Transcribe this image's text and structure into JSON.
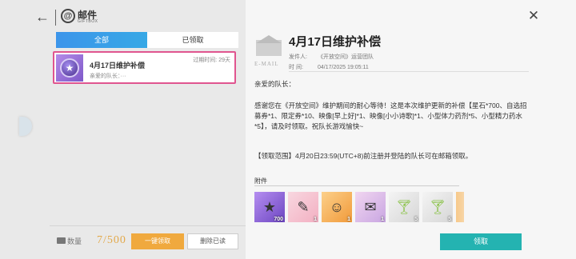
{
  "header": {
    "title": "邮件",
    "subtitle": "GIFTBOX"
  },
  "tabs": [
    {
      "label": "全部",
      "active": true
    },
    {
      "label": "已领取",
      "active": false
    }
  ],
  "mail_list": [
    {
      "title": "4月17日维护补偿",
      "expire": "过期时间: 29天",
      "preview": "亲爱的队长：···",
      "selected": true
    }
  ],
  "footer": {
    "count_label": "数量",
    "count_value": "7/500",
    "claim_all_label": "一键领取",
    "delete_read_label": "删除已读"
  },
  "detail": {
    "envelope_label": "E-MAIL",
    "title": "4月17日维护补偿",
    "sender_key": "发件人:",
    "sender_value": "《开放空间》运营团队",
    "time_key": "时  间:",
    "time_value": "04/17/2025 19:05:11",
    "greeting": "亲爱的队长：",
    "paragraph1": "感谢您在《开放空间》维护期间的耐心等待！这是本次维护更新的补偿【星石*700、自选招募券*1、限定券*10、映像[早上好]*1、映像[小小诗歌]*1、小型体力药剂*5、小型精力药水*5】，请及时领取。祝队长游戏愉快~",
    "paragraph2": "【领取范围】4月20日23:59(UTC+8)前注册并登陆的队长可在邮箱领取。",
    "attachments_label": "附件",
    "claim_label": "领取"
  },
  "attachments": [
    {
      "name": "star-stone",
      "qty": "700",
      "color": "purple",
      "glyph": "★"
    },
    {
      "name": "recruit-ticket",
      "qty": "1",
      "color": "pink",
      "glyph": "🎫"
    },
    {
      "name": "image-morning",
      "qty": "1",
      "color": "orange",
      "glyph": "☺"
    },
    {
      "name": "image-poem",
      "qty": "1",
      "color": "lilac",
      "glyph": "✉"
    },
    {
      "name": "stamina-potion",
      "qty": "5",
      "color": "grey",
      "glyph": "🍸"
    },
    {
      "name": "energy-potion",
      "qty": "5",
      "color": "grey",
      "glyph": "🍸"
    },
    {
      "name": "partial-item",
      "qty": "",
      "color": "fade",
      "glyph": ""
    }
  ],
  "colors": {
    "accent_blue": "#3c95ea",
    "highlight_pink": "#e0558f",
    "claim_all_orange": "#f0a93e",
    "claim_teal": "#24b3b1"
  }
}
